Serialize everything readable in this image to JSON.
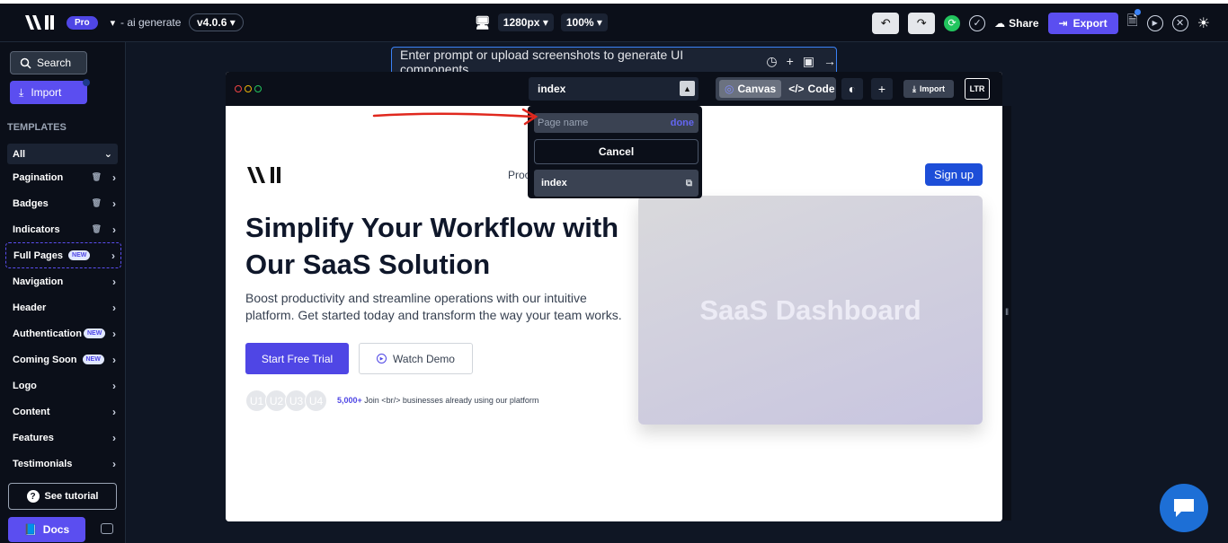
{
  "topbar": {
    "plan": "Pro",
    "mode": "- ai generate",
    "version": "v4.0.6",
    "viewport": "1280px",
    "zoom": "100%",
    "share_label": "Share",
    "export_label": "Export"
  },
  "sidebar": {
    "search_label": "Search",
    "import_label": "Import",
    "templates_heading": "TEMPLATES",
    "filter_value": "All",
    "items": [
      {
        "label": "Pagination",
        "badge": ""
      },
      {
        "label": "Badges",
        "badge": ""
      },
      {
        "label": "Indicators",
        "badge": ""
      },
      {
        "label": "Full Pages",
        "badge": "NEW"
      },
      {
        "label": "Navigation",
        "badge": ""
      },
      {
        "label": "Header",
        "badge": ""
      },
      {
        "label": "Authentication",
        "badge": "NEW"
      },
      {
        "label": "Coming Soon",
        "badge": "NEW"
      },
      {
        "label": "Logo",
        "badge": ""
      },
      {
        "label": "Content",
        "badge": ""
      },
      {
        "label": "Features",
        "badge": ""
      },
      {
        "label": "Testimonials",
        "badge": ""
      }
    ],
    "tutorial_label": "See tutorial",
    "docs_label": "Docs"
  },
  "prompt": {
    "placeholder": "Enter prompt or upload screenshots to generate UI components..."
  },
  "frame": {
    "page_select": "index",
    "canvas_label": "Canvas",
    "code_label": "Code",
    "import_label": "Import",
    "dir_label": "LTR"
  },
  "dropdown": {
    "input_placeholder": "Page name",
    "done_label": "done",
    "cancel_label": "Cancel",
    "pages": [
      "index"
    ]
  },
  "preview": {
    "nav_partial": "Proc",
    "signup_label": "Sign up",
    "hero_title": "Simplify Your Workflow with Our SaaS Solution",
    "hero_desc": "Boost productivity and streamline operations with our intuitive platform. Get started today and transform the way your team works.",
    "cta_primary": "Start Free Trial",
    "cta_secondary": "Watch Demo",
    "avatars": [
      "U1",
      "U2",
      "U3",
      "U4"
    ],
    "proof_count": "5,000+",
    "proof_text": "Join <br/> businesses already using our platform",
    "dashboard_label": "SaaS Dashboard"
  },
  "colors": {
    "accent": "#5b4ef0",
    "annotation_arrow": "#e0281e",
    "chat_bubble": "#1d6fd6"
  }
}
